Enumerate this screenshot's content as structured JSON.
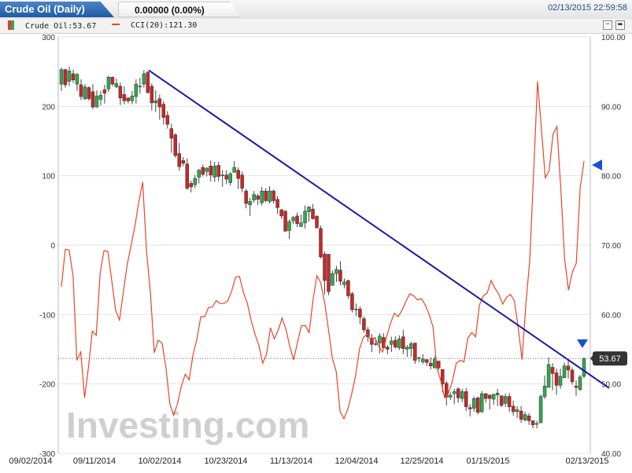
{
  "header": {
    "instrument_tab": "Crude Oil (Daily)",
    "price_change": "0.00000 (0.00%)",
    "timestamp": "02/13/2015 22:59:58"
  },
  "legend": {
    "items": [
      {
        "label": "Crude Oil:53.67",
        "color": "#2fa84f",
        "icon": "candle-icon"
      },
      {
        "label": "CCI(20):121.30",
        "color": "#e8442a",
        "icon": "line-dash-icon"
      }
    ],
    "minimize_glyph": "−",
    "restore_glyph": "▬"
  },
  "chart_data": {
    "type": "line",
    "watermark": "Investing.com",
    "x_tick_labels": [
      "09/02/2014",
      "09/11/2014",
      "10/02/2014",
      "10/23/2014",
      "11/13/2014",
      "12/04/2014",
      "12/25/2014",
      "01/15/2015",
      "02/13/2015"
    ],
    "left_axis_cci": {
      "ticks": [
        300,
        200,
        100,
        0,
        -100,
        -200,
        -300
      ],
      "range": [
        -300,
        300
      ]
    },
    "right_axis_price": {
      "ticks": [
        "100.00",
        "90.00",
        "80.00",
        "70.00",
        "60.00",
        "50.00",
        "40.00"
      ],
      "range": [
        40,
        100
      ]
    },
    "last_price_label": "53.67",
    "last_price": 53.67,
    "trendline": {
      "from_price": 95.2,
      "to_price": 49.4
    },
    "series": [
      {
        "name": "Crude Oil",
        "kind": "candlestick",
        "candles": [
          [
            93.2,
            95.3,
            92.2,
            95.6
          ],
          [
            95.3,
            93.1,
            92.7,
            95.4
          ],
          [
            93.6,
            95.1,
            92.9,
            95.7
          ],
          [
            94.7,
            93.8,
            93.4,
            95.3
          ],
          [
            93.2,
            94.6,
            92.2,
            94.8
          ],
          [
            93.1,
            91.4,
            90.9,
            93.9
          ],
          [
            91.1,
            92.8,
            90.9,
            93.2
          ],
          [
            92.7,
            91.1,
            90.8,
            92.9
          ],
          [
            92.1,
            89.9,
            89.6,
            93.2
          ],
          [
            89.9,
            91.5,
            89.8,
            92.3
          ],
          [
            91.0,
            91.6,
            90.1,
            92.2
          ],
          [
            92.4,
            91.9,
            90.4,
            93.1
          ],
          [
            92.5,
            94.2,
            92.1,
            94.4
          ],
          [
            94.2,
            93.2,
            92.9,
            94.3
          ],
          [
            92.8,
            93.3,
            92.6,
            94.0
          ],
          [
            92.9,
            91.2,
            90.2,
            93.4
          ],
          [
            91.7,
            90.8,
            90.3,
            92.9
          ],
          [
            91.2,
            90.8,
            90.4,
            91.3
          ],
          [
            90.8,
            91.5,
            90.3,
            92.2
          ],
          [
            91.4,
            93.2,
            90.4,
            93.9
          ],
          [
            92.9,
            92.9,
            91.8,
            94.1
          ],
          [
            93.2,
            94.7,
            92.7,
            95.2
          ],
          [
            94.9,
            92.0,
            91.8,
            95.1
          ],
          [
            92.9,
            90.5,
            89.4,
            93.3
          ],
          [
            90.5,
            90.8,
            89.2,
            92.3
          ],
          [
            91.1,
            89.9,
            88.1,
            91.7
          ],
          [
            90.3,
            88.4,
            87.4,
            90.8
          ],
          [
            88.7,
            87.4,
            86.8,
            89.3
          ],
          [
            86.8,
            85.4,
            83.3,
            87.5
          ],
          [
            85.9,
            82.9,
            82.6,
            86.1
          ],
          [
            83.2,
            81.3,
            80.7,
            84.7
          ],
          [
            82.2,
            81.8,
            81.4,
            82.7
          ],
          [
            81.7,
            78.2,
            78.0,
            82.5
          ],
          [
            78.9,
            78.4,
            77.6,
            79.3
          ],
          [
            78.7,
            79.6,
            78.2,
            80.1
          ],
          [
            79.8,
            80.8,
            78.9,
            81.0
          ],
          [
            81.2,
            80.2,
            79.9,
            81.6
          ],
          [
            80.6,
            81.1,
            79.9,
            81.2
          ],
          [
            81.4,
            80.1,
            79.2,
            82.2
          ],
          [
            79.8,
            81.4,
            79.1,
            82.0
          ],
          [
            81.5,
            79.9,
            79.2,
            82.0
          ],
          [
            80.1,
            80.1,
            78.4,
            80.8
          ],
          [
            80.1,
            79.5,
            78.8,
            80.8
          ],
          [
            79.0,
            80.3,
            78.6,
            80.5
          ],
          [
            80.5,
            81.2,
            80.4,
            82.1
          ],
          [
            80.8,
            79.6,
            78.1,
            81.2
          ],
          [
            80.1,
            78.2,
            77.6,
            80.6
          ],
          [
            77.8,
            76.0,
            75.3,
            78.1
          ],
          [
            75.8,
            76.3,
            74.2,
            76.8
          ],
          [
            76.5,
            77.3,
            76.1,
            77.8
          ],
          [
            77.1,
            76.6,
            75.8,
            77.4
          ],
          [
            76.1,
            77.8,
            75.7,
            78.4
          ],
          [
            77.8,
            76.4,
            76.2,
            78.2
          ],
          [
            76.3,
            77.8,
            76.0,
            78.5
          ],
          [
            77.8,
            76.4,
            76.0,
            78.0
          ],
          [
            76.6,
            75.4,
            74.5,
            77.1
          ],
          [
            75.1,
            74.2,
            73.8,
            75.2
          ],
          [
            74.9,
            72.0,
            72.2,
            75.0
          ],
          [
            72.1,
            73.4,
            70.9,
            73.7
          ],
          [
            73.5,
            74.0,
            73.0,
            74.2
          ],
          [
            74.2,
            73.1,
            72.6,
            74.7
          ],
          [
            72.7,
            73.2,
            72.6,
            74.4
          ],
          [
            73.2,
            74.9,
            72.4,
            75.7
          ],
          [
            74.8,
            75.5,
            73.4,
            75.6
          ],
          [
            75.2,
            73.8,
            73.7,
            75.9
          ],
          [
            74.2,
            72.5,
            72.4,
            74.2
          ],
          [
            72.4,
            68.3,
            68.1,
            72.8
          ],
          [
            68.7,
            64.9,
            62.9,
            69.1
          ],
          [
            68.7,
            63.3,
            62.8,
            68.5
          ],
          [
            64.2,
            65.9,
            64.3,
            66.3
          ],
          [
            65.9,
            66.5,
            64.7,
            67.0
          ],
          [
            66.4,
            64.8,
            64.2,
            67.7
          ],
          [
            64.3,
            64.7,
            63.8,
            65.2
          ],
          [
            64.9,
            62.7,
            62.3,
            65.0
          ],
          [
            63.0,
            60.7,
            60.3,
            63.3
          ],
          [
            60.7,
            60.8,
            59.8,
            61.6
          ],
          [
            60.8,
            59.6,
            58.6,
            61.2
          ],
          [
            59.4,
            57.8,
            57.4,
            59.7
          ],
          [
            57.8,
            56.8,
            56.1,
            58.2
          ],
          [
            56.6,
            55.7,
            54.6,
            57.2
          ],
          [
            55.8,
            55.8,
            55.5,
            56.6
          ],
          [
            55.9,
            56.9,
            54.4,
            57.3
          ],
          [
            56.7,
            55.2,
            55.0,
            57.3
          ],
          [
            55.3,
            55.0,
            54.3,
            55.6
          ],
          [
            55.7,
            56.2,
            54.6,
            56.8
          ],
          [
            56.3,
            55.3,
            55.1,
            56.9
          ],
          [
            55.2,
            56.5,
            54.9,
            57.0
          ],
          [
            56.8,
            55.1,
            54.3,
            57.8
          ],
          [
            55.0,
            55.3,
            53.9,
            55.6
          ],
          [
            55.1,
            55.8,
            53.9,
            56.1
          ],
          [
            55.9,
            53.4,
            52.9,
            55.9
          ],
          [
            53.7,
            53.8,
            53.1,
            53.9
          ],
          [
            53.2,
            53.6,
            52.9,
            54.3
          ],
          [
            53.5,
            53.1,
            52.6,
            53.6
          ],
          [
            53.0,
            52.6,
            52.1,
            53.8
          ],
          [
            52.3,
            53.6,
            52.4,
            54.0
          ],
          [
            53.3,
            52.3,
            52.0,
            53.3
          ],
          [
            52.1,
            50.0,
            48.8,
            52.1
          ],
          [
            50.1,
            48.1,
            46.9,
            50.4
          ],
          [
            48.1,
            48.4,
            47.7,
            48.8
          ],
          [
            48.6,
            48.9,
            47.1,
            49.3
          ],
          [
            49.3,
            48.0,
            47.3,
            49.5
          ],
          [
            47.9,
            48.9,
            47.4,
            49.3
          ],
          [
            48.9,
            46.7,
            46.1,
            49.4
          ],
          [
            46.6,
            46.4,
            45.3,
            47.1
          ],
          [
            46.5,
            47.9,
            46.0,
            48.2
          ],
          [
            48.0,
            45.9,
            45.6,
            48.2
          ],
          [
            46.0,
            48.6,
            45.8,
            49.0
          ],
          [
            48.6,
            47.9,
            47.3,
            48.7
          ],
          [
            48.4,
            47.9,
            46.3,
            48.3
          ],
          [
            47.8,
            48.5,
            47.0,
            48.6
          ],
          [
            48.4,
            48.7,
            46.8,
            49.3
          ],
          [
            48.3,
            46.9,
            46.7,
            48.2
          ],
          [
            47.2,
            48.2,
            46.7,
            48.6
          ],
          [
            48.2,
            46.7,
            46.0,
            48.7
          ],
          [
            46.8,
            46.0,
            45.4,
            47.6
          ],
          [
            46.0,
            46.3,
            45.1,
            46.8
          ],
          [
            46.1,
            44.9,
            44.4,
            46.8
          ],
          [
            44.8,
            45.6,
            44.6,
            46.0
          ],
          [
            45.4,
            44.7,
            44.1,
            45.8
          ],
          [
            44.7,
            44.1,
            43.6,
            44.6
          ],
          [
            44.2,
            44.3,
            43.6,
            44.7
          ],
          [
            44.4,
            48.2,
            44.5,
            48.5
          ],
          [
            48.2,
            49.7,
            47.8,
            51.2
          ],
          [
            49.5,
            52.8,
            49.6,
            53.8
          ],
          [
            52.4,
            51.5,
            49.1,
            53.0
          ],
          [
            51.6,
            49.8,
            48.4,
            52.2
          ],
          [
            49.8,
            51.1,
            49.3,
            52.2
          ],
          [
            50.9,
            52.6,
            50.8,
            53.1
          ],
          [
            52.6,
            52.0,
            50.8,
            53.6
          ],
          [
            52.0,
            50.3,
            49.9,
            52.4
          ],
          [
            49.7,
            49.5,
            48.3,
            50.5
          ],
          [
            49.2,
            51.0,
            49.0,
            51.3
          ],
          [
            51.1,
            53.7,
            50.8,
            53.8
          ]
        ]
      },
      {
        "name": "CCI(20)",
        "kind": "line",
        "values": [
          -60,
          -6,
          -7,
          -44,
          -166,
          -154,
          -220,
          -176,
          -124,
          -130,
          -41,
          -8,
          -9,
          -50,
          -94,
          -108,
          -68,
          -28,
          -1,
          28,
          63,
          91,
          -9,
          -68,
          -155,
          -137,
          -141,
          -176,
          -228,
          -245,
          -228,
          -203,
          -186,
          -194,
          -158,
          -136,
          -103,
          -103,
          -90,
          -89,
          -80,
          -84,
          -84,
          -80,
          -66,
          -46,
          -45,
          -68,
          -83,
          -108,
          -128,
          -144,
          -170,
          -157,
          -119,
          -135,
          -123,
          -105,
          -121,
          -146,
          -165,
          -140,
          -116,
          -116,
          -126,
          -79,
          -44,
          -54,
          -83,
          -122,
          -163,
          -182,
          -240,
          -250,
          -236,
          -214,
          -188,
          -150,
          -133,
          -128,
          -137,
          -133,
          -146,
          -154,
          -132,
          -113,
          -98,
          -103,
          -94,
          -81,
          -70,
          -73,
          -79,
          -77,
          -86,
          -100,
          -118,
          -177,
          -195,
          -220,
          -213,
          -196,
          -170,
          -166,
          -168,
          -134,
          -126,
          -132,
          -86,
          -73,
          -69,
          -51,
          -62,
          -71,
          -85,
          -75,
          -71,
          -80,
          -119,
          -165,
          -84,
          -22,
          107,
          236,
          168,
          97,
          107,
          160,
          171,
          82,
          -20,
          -65,
          -39,
          -26,
          82,
          121
        ]
      }
    ]
  }
}
